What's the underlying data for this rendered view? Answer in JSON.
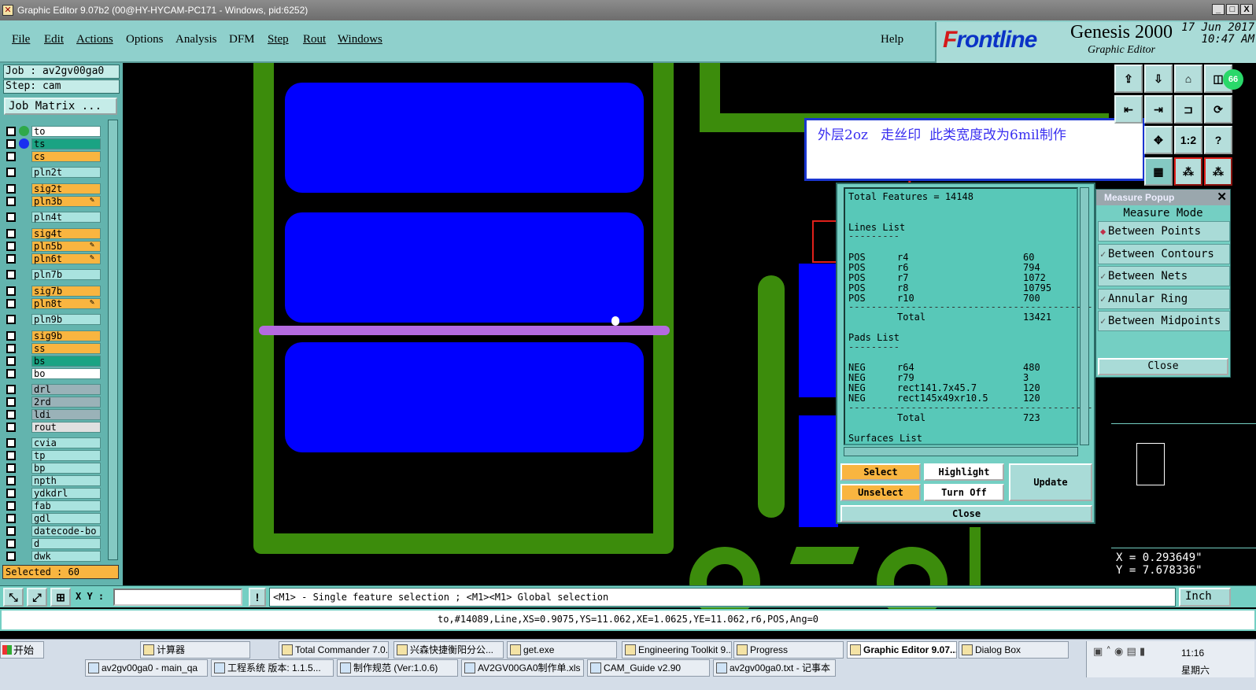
{
  "window": {
    "title": "Graphic Editor 9.07b2 (00@HY-HYCAM-PC171 - Windows, pid:6252)",
    "minimize": "_",
    "maximize": "□",
    "close": "X"
  },
  "menu": {
    "items": [
      "File",
      "Edit",
      "Actions",
      "Options",
      "Analysis",
      "DFM",
      "Step",
      "Rout",
      "Windows"
    ],
    "help": "Help"
  },
  "brand": {
    "logo_f": "F",
    "logo_rest": "rontline",
    "product": "Genesis 2000",
    "subtitle": "Graphic Editor",
    "date": "17 Jun 2017",
    "time": "10:47 AM"
  },
  "left": {
    "job": "Job : av2gv00ga0",
    "step": "Step: cam",
    "job_matrix": "Job Matrix ...",
    "selected": "Selected : 60"
  },
  "layers": [
    {
      "name": "to",
      "color": "#ffffff"
    },
    {
      "name": "ts",
      "color": "#1aa383"
    },
    {
      "name": "cs",
      "color": "#f9b540"
    },
    {
      "name": "pln2t",
      "color": "#a9e3df"
    },
    {
      "name": "sig2t",
      "color": "#f9b540"
    },
    {
      "name": "pln3b",
      "color": "#f9b540"
    },
    {
      "name": "pln4t",
      "color": "#a9e3df"
    },
    {
      "name": "sig4t",
      "color": "#f9b540"
    },
    {
      "name": "pln5b",
      "color": "#f9b540"
    },
    {
      "name": "pln6t",
      "color": "#f9b540"
    },
    {
      "name": "pln7b",
      "color": "#a9e3df"
    },
    {
      "name": "sig7b",
      "color": "#f9b540"
    },
    {
      "name": "pln8t",
      "color": "#f9b540"
    },
    {
      "name": "pln9b",
      "color": "#a9e3df"
    },
    {
      "name": "sig9b",
      "color": "#f9b540"
    },
    {
      "name": "ss",
      "color": "#f9b540"
    },
    {
      "name": "bs",
      "color": "#1aa383"
    },
    {
      "name": "bo",
      "color": "#ffffff"
    },
    {
      "name": "drl",
      "color": "#9ab2b8"
    },
    {
      "name": "2rd",
      "color": "#9ab2b8"
    },
    {
      "name": "ldi",
      "color": "#9ab2b8"
    },
    {
      "name": "rout",
      "color": "#e0e0e0"
    },
    {
      "name": "cvia",
      "color": "#a9e3df"
    },
    {
      "name": "tp",
      "color": "#a9e3df"
    },
    {
      "name": "bp",
      "color": "#a9e3df"
    },
    {
      "name": "npth",
      "color": "#a9e3df"
    },
    {
      "name": "ydkdrl",
      "color": "#a9e3df"
    },
    {
      "name": "fab",
      "color": "#a9e3df"
    },
    {
      "name": "gdl",
      "color": "#a9e3df"
    },
    {
      "name": "datecode-bo",
      "color": "#a9e3df"
    },
    {
      "name": "d",
      "color": "#a9e3df"
    },
    {
      "name": "dwk",
      "color": "#a9e3df"
    }
  ],
  "annotation": {
    "text": "外层2oz   走丝印  此类宽度改为6mil制作"
  },
  "features": {
    "total": "Total Features = 14148",
    "lines_title": "Lines List",
    "lines": [
      {
        "pol": "POS",
        "sym": "r4",
        "count": "60"
      },
      {
        "pol": "POS",
        "sym": "r6",
        "count": "794"
      },
      {
        "pol": "POS",
        "sym": "r7",
        "count": "1072"
      },
      {
        "pol": "POS",
        "sym": "r8",
        "count": "10795"
      },
      {
        "pol": "POS",
        "sym": "r10",
        "count": "700"
      }
    ],
    "lines_total_label": "Total",
    "lines_total": "13421",
    "pads_title": "Pads List",
    "pads": [
      {
        "pol": "NEG",
        "sym": "r64",
        "count": "480"
      },
      {
        "pol": "NEG",
        "sym": "r79",
        "count": "3"
      },
      {
        "pol": "NEG",
        "sym": "rect141.7x45.7",
        "count": "120"
      },
      {
        "pol": "NEG",
        "sym": "rect145x49xr10.5",
        "count": "120"
      }
    ],
    "pads_total_label": "Total",
    "pads_total": "723",
    "surfaces_title": "Surfaces List",
    "buttons": {
      "select": "Select",
      "unselect": "Unselect",
      "highlight": "Highlight",
      "turn_off": "Turn Off",
      "update": "Update",
      "close": "Close"
    }
  },
  "measure": {
    "title": "Measure Popup",
    "mode_label": "Measure Mode",
    "options": [
      "Between Points",
      "Between Contours",
      "Between Nets",
      "Annular Ring",
      "Between Midpoints"
    ],
    "close": "Close"
  },
  "tools": {
    "scale_label": "1:2",
    "help_label": "?",
    "badge": "66"
  },
  "coords": {
    "x": "X = 0.293649\"",
    "y": "Y = 7.678336\""
  },
  "command": {
    "xy_label": "X Y :",
    "xy_value": "",
    "hint": "<M1> - Single feature selection ; <M1><M1> Global selection",
    "units": "Inch"
  },
  "status": {
    "text": "to,#14089,Line,XS=0.9075,YS=11.062,XE=1.0625,YE=11.062,r6,POS,Ang=0"
  },
  "taskbar": {
    "start": "开始",
    "row1": [
      "计算器",
      "Total Commander 7.0...",
      "兴森快捷衡阳分公...",
      "get.exe",
      "Engineering Toolkit 9....",
      "Progress",
      "Graphic Editor 9.07...",
      "Dialog Box"
    ],
    "row2": [
      "av2gv00ga0 - main_qa",
      "工程系统  版本: 1.1.5...",
      "制作规范 (Ver:1.0.6)",
      "AV2GV00GA0制作单.xls ...",
      "CAM_Guide v2.90",
      "av2gv00ga0.txt - 记事本"
    ],
    "clock": "11:16",
    "weekday": "星期六"
  }
}
